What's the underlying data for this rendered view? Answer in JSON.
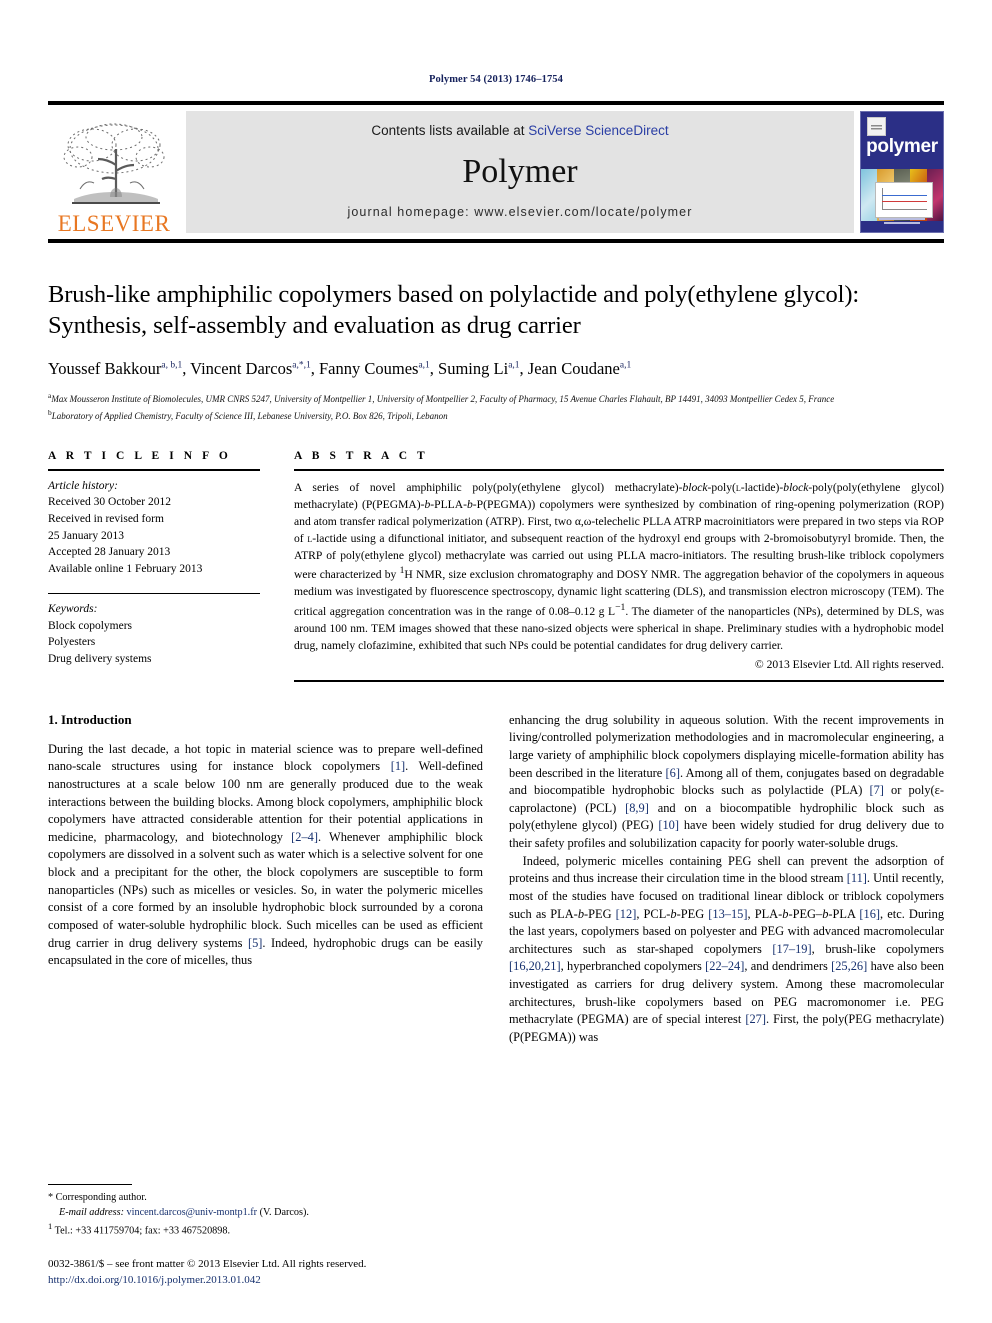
{
  "running_head": "Polymer 54 (2013) 1746–1754",
  "masthead": {
    "publisher_name": "ELSEVIER",
    "contents_prefix": "Contents lists available at ",
    "contents_link": "SciVerse ScienceDirect",
    "journal_title": "Polymer",
    "homepage": "journal homepage: www.elsevier.com/locate/polymer",
    "cover_word": "polymer",
    "link_color": "#2b3fa5"
  },
  "article": {
    "title": "Brush-like amphiphilic copolymers based on polylactide and poly(ethylene glycol): Synthesis, self-assembly and evaluation as drug carrier",
    "authors": [
      {
        "name": "Youssef Bakkour",
        "marks": "a, b,1"
      },
      {
        "name": "Vincent Darcos",
        "marks": "a,*,1"
      },
      {
        "name": "Fanny Coumes",
        "marks": "a,1"
      },
      {
        "name": "Suming Li",
        "marks": "a,1"
      },
      {
        "name": "Jean Coudane",
        "marks": "a,1"
      }
    ],
    "affiliations": [
      {
        "mark": "a",
        "text": "Max Mousseron Institute of Biomolecules, UMR CNRS 5247, University of Montpellier 1, University of Montpellier 2, Faculty of Pharmacy, 15 Avenue Charles Flahault, BP 14491, 34093 Montpellier Cedex 5, France"
      },
      {
        "mark": "b",
        "text": "Laboratory of Applied Chemistry, Faculty of Science III, Lebanese University, P.O. Box 826, Tripoli, Lebanon"
      }
    ]
  },
  "article_info": {
    "heading": "A R T I C L E    I N F O",
    "history_label": "Article history:",
    "history": [
      "Received 30 October 2012",
      "Received in revised form",
      "25 January 2013",
      "Accepted 28 January 2013",
      "Available online 1 February 2013"
    ],
    "keywords_label": "Keywords:",
    "keywords": [
      "Block copolymers",
      "Polyesters",
      "Drug delivery systems"
    ]
  },
  "abstract": {
    "heading": "A B S T R A C T",
    "paragraph_html": "A series of novel amphiphilic poly(poly(ethylene glycol) methacrylate)-<i>block</i>-poly(<span style=\"font-variant:small-caps\">l</span>-lactide)-<i>block</i>-poly(poly(ethylene glycol) methacrylate) (P(PEGMA)-<i>b</i>-PLLA-<i>b</i>-P(PEGMA)) copolymers were synthesized by combination of ring-opening polymerization (ROP) and atom transfer radical polymerization (ATRP). First, two &alpha;,&omega;-telechelic PLLA ATRP macroinitiators were prepared in two steps via ROP of <span style=\"font-variant:small-caps\">l</span>-lactide using a difunctional initiator, and subsequent reaction of the hydroxyl end groups with 2-bromoisobutyryl bromide. Then, the ATRP of poly(ethylene glycol) methacrylate was carried out using PLLA macro-initiators. The resulting brush-like triblock copolymers were characterized by <sup>1</sup>H NMR, size exclusion chromatography and DOSY NMR. The aggregation behavior of the copolymers in aqueous medium was investigated by fluorescence spectroscopy, dynamic light scattering (DLS), and transmission electron microscopy (TEM). The critical aggregation concentration was in the range of 0.08&ndash;0.12 g L<sup>&minus;1</sup>. The diameter of the nanoparticles (NPs), determined by DLS, was around 100 nm. TEM images showed that these nano-sized objects were spherical in shape. Preliminary studies with a hydrophobic model drug, namely clofazimine, exhibited that such NPs could be potential candidates for drug delivery carrier.",
    "copyright": "© 2013 Elsevier Ltd. All rights reserved."
  },
  "introduction": {
    "heading": "1. Introduction",
    "left_paragraphs_html": [
      "During the last decade, a hot topic in material science was to prepare well-defined nano-scale structures using for instance block copolymers <span class=\"ref\">[1]</span>. Well-defined nanostructures at a scale below 100 nm are generally produced due to the weak interactions between the building blocks. Among block copolymers, amphiphilic block copolymers have attracted considerable attention for their potential applications in medicine, pharmacology, and biotechnology <span class=\"ref\">[2&ndash;4]</span>. Whenever amphiphilic block copolymers are dissolved in a solvent such as water which is a selective solvent for one block and a precipitant for the other, the block copolymers are susceptible to form nanoparticles (NPs) such as micelles or vesicles. So, in water the polymeric micelles consist of a core formed by an insoluble hydrophobic block surrounded by a corona composed of water-soluble hydrophilic block. Such micelles can be used as efficient drug carrier in drug delivery systems <span class=\"ref\">[5]</span>. Indeed, hydrophobic drugs can be easily encapsulated in the core of micelles, thus"
    ],
    "right_paragraphs_html": [
      "enhancing the drug solubility in aqueous solution. With the recent improvements in living/controlled polymerization methodologies and in macromolecular engineering, a large variety of amphiphilic block copolymers displaying micelle-formation ability has been described in the literature <span class=\"ref\">[6]</span>. Among all of them, conjugates based on degradable and biocompatible hydrophobic blocks such as polylactide (PLA) <span class=\"ref\">[7]</span> or poly(&epsilon;-caprolactone) (PCL) <span class=\"ref\">[8,9]</span> and on a biocompatible hydrophilic block such as poly(ethylene glycol) (PEG) <span class=\"ref\">[10]</span> have been widely studied for drug delivery due to their safety profiles and solubilization capacity for poorly water-soluble drugs.",
      "Indeed, polymeric micelles containing PEG shell can prevent the adsorption of proteins and thus increase their circulation time in the blood stream <span class=\"ref\">[11]</span>. Until recently, most of the studies have focused on traditional linear diblock or triblock copolymers such as PLA-<i>b</i>-PEG <span class=\"ref\">[12]</span>, PCL-<i>b</i>-PEG <span class=\"ref\">[13&ndash;15]</span>, PLA-<i>b</i>-PEG&ndash;<i>b</i>-PLA <span class=\"ref\">[16]</span>, etc. During the last years, copolymers based on polyester and PEG with advanced macromolecular architectures such as star-shaped copolymers <span class=\"ref\">[17&ndash;19]</span>, brush-like copolymers <span class=\"ref\">[16,20,21]</span>, hyperbranched copolymers <span class=\"ref\">[22&ndash;24]</span>, and dendrimers <span class=\"ref\">[25,26]</span> have also been investigated as carriers for drug delivery system. Among these macromolecular architectures, brush-like copolymers based on PEG macromonomer i.e. PEG methacrylate (PEGMA) are of special interest <span class=\"ref\">[27]</span>. First, the poly(PEG methacrylate) (P(PEGMA)) was"
    ]
  },
  "footnotes": {
    "corresponding": "* Corresponding author.",
    "email_label": "E-mail address:",
    "email": "vincent.darcos@univ-montp1.fr",
    "email_suffix": " (V. Darcos).",
    "tel_mark": "1",
    "tel": "Tel.: +33 411759704; fax: +33 467520898.",
    "issn_line": "0032-3861/$ – see front matter © 2013 Elsevier Ltd. All rights reserved.",
    "doi": "http://dx.doi.org/10.1016/j.polymer.2013.01.042"
  }
}
